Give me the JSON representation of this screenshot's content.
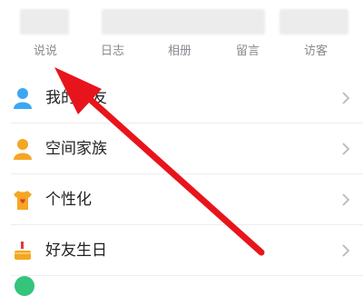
{
  "stats": {
    "tabs": [
      {
        "label": "说说"
      },
      {
        "label": "日志"
      },
      {
        "label": "相册"
      },
      {
        "label": "留言"
      },
      {
        "label": "访客"
      }
    ]
  },
  "menu": {
    "items": [
      {
        "label": "我的好友",
        "icon": "friend-person-icon",
        "color": "#3aa7f5"
      },
      {
        "label": "空间家族",
        "icon": "family-person-icon",
        "color": "#f5a623"
      },
      {
        "label": "个性化",
        "icon": "tshirt-icon",
        "color": "#f5a623"
      },
      {
        "label": "好友生日",
        "icon": "cake-icon",
        "color": "#f5a623"
      }
    ]
  },
  "annotation": {
    "arrow_color": "#e8141c"
  }
}
